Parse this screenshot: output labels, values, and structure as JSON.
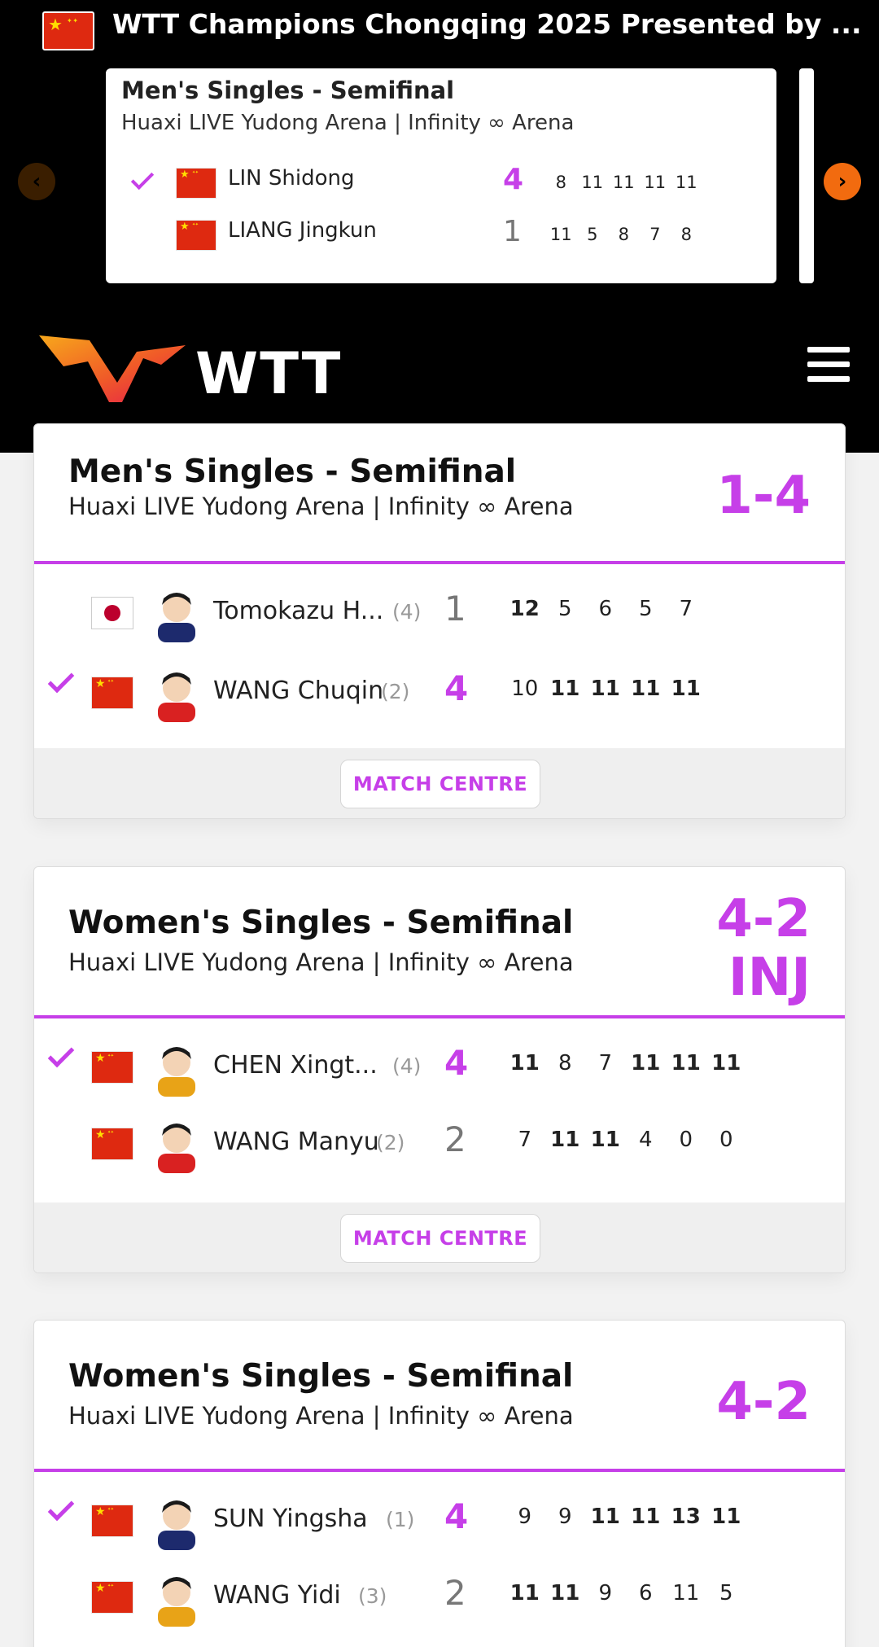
{
  "event": {
    "title": "WTT Champions Chongqing 2025 Presented by ..."
  },
  "live": {
    "title": "Men's Singles - Semifinal",
    "venue": "Huaxi LIVE Yudong Arena | Infinity ∞ Arena",
    "players": [
      {
        "name": "LIN Shidong",
        "score": "4",
        "games": [
          "8",
          "11",
          "11",
          "11",
          "11"
        ],
        "winner": true
      },
      {
        "name": "LIANG Jingkun",
        "score": "1",
        "games": [
          "11",
          "5",
          "8",
          "7",
          "8"
        ],
        "winner": false
      }
    ]
  },
  "brand": {
    "logo_text": "WTT"
  },
  "colors": {
    "accent": "#c63fe8",
    "arrow": "#f26b0f"
  },
  "icons": {
    "menu": "hamburger-icon",
    "prev": "chevron-left-icon",
    "next": "chevron-right-icon",
    "check": "check-icon"
  },
  "matches": [
    {
      "title": "Men's Singles - Semifinal",
      "venue": "Huaxi LIVE Yudong Arena | Infinity ∞ Arena",
      "score": "1-4",
      "status": "",
      "players": [
        {
          "name": "Tomokazu H...",
          "seed": "(4)",
          "score": "1",
          "games": [
            "12",
            "5",
            "6",
            "5",
            "7"
          ],
          "winner": false,
          "country": "JPN"
        },
        {
          "name": "WANG Chuqin",
          "seed": "(2)",
          "score": "4",
          "games": [
            "10",
            "11",
            "11",
            "11",
            "11"
          ],
          "winner": true,
          "country": "CHN"
        }
      ],
      "button": "MATCH CENTRE"
    },
    {
      "title": "Women's Singles - Semifinal",
      "venue": "Huaxi LIVE Yudong Arena | Infinity ∞ Arena",
      "score": "4-2",
      "status": "INJ",
      "players": [
        {
          "name": "CHEN Xingt...",
          "seed": "(4)",
          "score": "4",
          "games": [
            "11",
            "8",
            "7",
            "11",
            "11",
            "11"
          ],
          "winner": true,
          "country": "CHN"
        },
        {
          "name": "WANG Manyu",
          "seed": "(2)",
          "score": "2",
          "games": [
            "7",
            "11",
            "11",
            "4",
            "0",
            "0"
          ],
          "winner": false,
          "country": "CHN"
        }
      ],
      "button": "MATCH CENTRE"
    },
    {
      "title": "Women's Singles - Semifinal",
      "venue": "Huaxi LIVE Yudong Arena | Infinity ∞ Arena",
      "score": "4-2",
      "status": "",
      "players": [
        {
          "name": "SUN Yingsha",
          "seed": "(1)",
          "score": "4",
          "games": [
            "9",
            "9",
            "11",
            "11",
            "13",
            "11"
          ],
          "winner": true,
          "country": "CHN"
        },
        {
          "name": "WANG Yidi",
          "seed": "(3)",
          "score": "2",
          "games": [
            "11",
            "11",
            "9",
            "6",
            "11",
            "5"
          ],
          "winner": false,
          "country": "CHN"
        }
      ]
    }
  ]
}
